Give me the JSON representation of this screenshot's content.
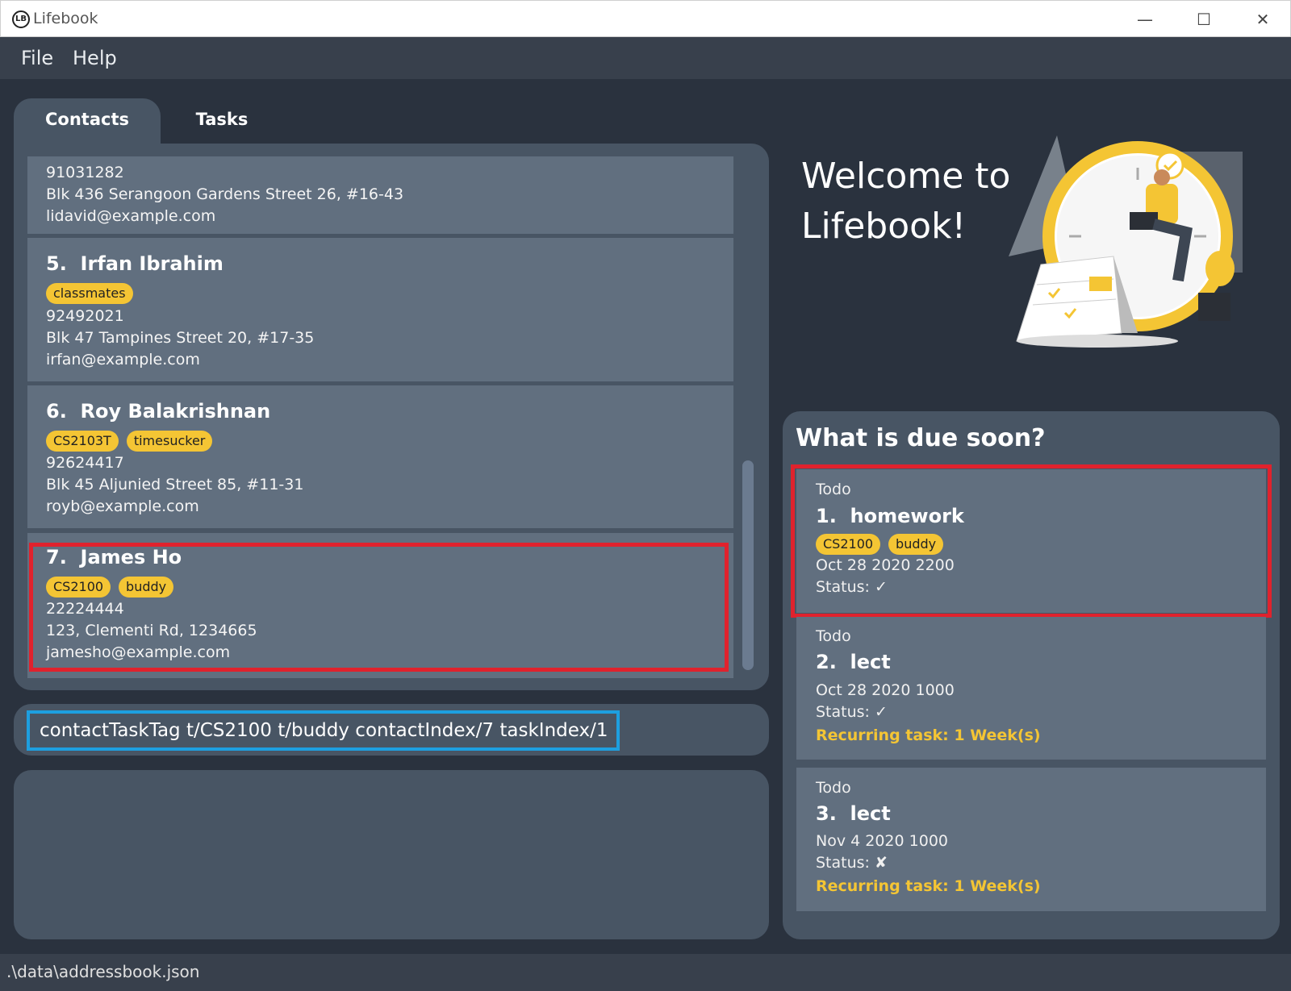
{
  "window": {
    "app_icon_text": "LB",
    "title": "Lifebook",
    "minimize": "—",
    "maximize": "☐",
    "close": "✕"
  },
  "menu": {
    "file": "File",
    "help": "Help"
  },
  "tabs": {
    "contacts": "Contacts",
    "tasks": "Tasks"
  },
  "contacts": {
    "partial": {
      "phone": "91031282",
      "address": "Blk 436 Serangoon Gardens Street 26, #16-43",
      "email": "lidavid@example.com"
    },
    "items": [
      {
        "index": "5.",
        "name": "Irfan Ibrahim",
        "tags": [
          "classmates"
        ],
        "phone": "92492021",
        "address": "Blk 47 Tampines Street 20, #17-35",
        "email": "irfan@example.com"
      },
      {
        "index": "6.",
        "name": "Roy Balakrishnan",
        "tags": [
          "CS2103T",
          "timesucker"
        ],
        "phone": "92624417",
        "address": "Blk 45 Aljunied Street 85, #11-31",
        "email": "royb@example.com"
      },
      {
        "index": "7.",
        "name": "James Ho",
        "tags": [
          "CS2100",
          "buddy"
        ],
        "phone": "22224444",
        "address": "123, Clementi Rd, 1234665",
        "email": "jamesho@example.com"
      }
    ]
  },
  "command": {
    "value": "contactTaskTag t/CS2100 t/buddy contactIndex/7 taskIndex/1"
  },
  "welcome": {
    "line1": "Welcome to",
    "line2": "Lifebook!"
  },
  "due": {
    "title": "What is due soon?",
    "tasks": [
      {
        "type": "Todo",
        "index": "1.",
        "name": "homework",
        "tags": [
          "CS2100",
          "buddy"
        ],
        "date": "Oct 28 2020 2200",
        "status": "Status: ✓"
      },
      {
        "type": "Todo",
        "index": "2.",
        "name": "lect",
        "date": "Oct 28 2020 1000",
        "status": "Status: ✓",
        "recurring": "Recurring task: 1 Week(s)"
      },
      {
        "type": "Todo",
        "index": "3.",
        "name": "lect",
        "date": "Nov 4 2020 1000",
        "status": "Status: ✘",
        "recurring": "Recurring task: 1 Week(s)"
      }
    ]
  },
  "status_bar": {
    "path": ".\\data\\addressbook.json"
  },
  "colors": {
    "tag": "#f4c534",
    "highlight": "#e0222d",
    "command_border": "#1d9fe0",
    "background": "#2a323e",
    "panel": "#485564",
    "card": "#616f7f"
  },
  "icons": {
    "illustration": "clock-calendar-illustration"
  }
}
